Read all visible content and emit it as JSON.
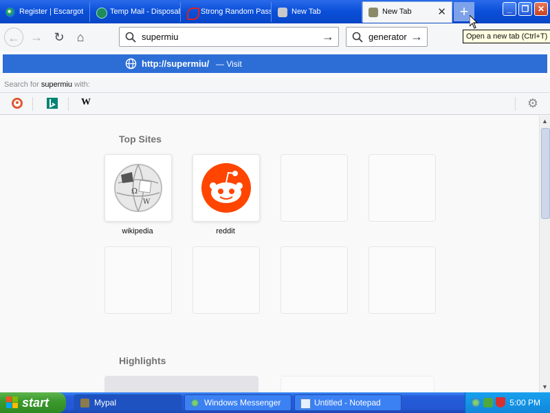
{
  "tabs": [
    {
      "label": "Register | Escargot",
      "icon": "escargot-icon"
    },
    {
      "label": "Temp Mail - Disposable",
      "icon": "tempmail-icon"
    },
    {
      "label": "Strong Random Password",
      "icon": "password-icon"
    },
    {
      "label": "New Tab",
      "icon": "mypal-icon"
    },
    {
      "label": "New Tab",
      "icon": "mypal-icon",
      "active": true
    }
  ],
  "tooltip": "Open a new tab (Ctrl+T)",
  "urlbar": {
    "value": "supermiu"
  },
  "searchbar": {
    "value": "generator"
  },
  "suggestion": {
    "url": "http://supermiu/",
    "action": "— Visit"
  },
  "search_for": {
    "prefix": "Search for ",
    "term": "supermiu",
    "suffix": " with:"
  },
  "engines": [
    "duckduckgo-icon",
    "bing-icon",
    "wikipedia-icon"
  ],
  "top_sites": {
    "title": "Top Sites",
    "tiles": [
      {
        "label": "wikipedia"
      },
      {
        "label": "reddit"
      },
      {
        "label": ""
      },
      {
        "label": ""
      },
      {
        "label": ""
      },
      {
        "label": ""
      },
      {
        "label": ""
      },
      {
        "label": ""
      }
    ]
  },
  "highlights": {
    "title": "Highlights"
  },
  "taskbar": {
    "start": "start",
    "items": [
      {
        "label": "Mypal"
      },
      {
        "label": "Windows Messenger"
      },
      {
        "label": "Untitled - Notepad"
      }
    ],
    "clock": "5:00 PM"
  },
  "colors": {
    "tabbar": "#0a4fd8",
    "suggestion": "#2d6ed6",
    "reddit": "#ff4500",
    "start": "#3c9b2e"
  }
}
